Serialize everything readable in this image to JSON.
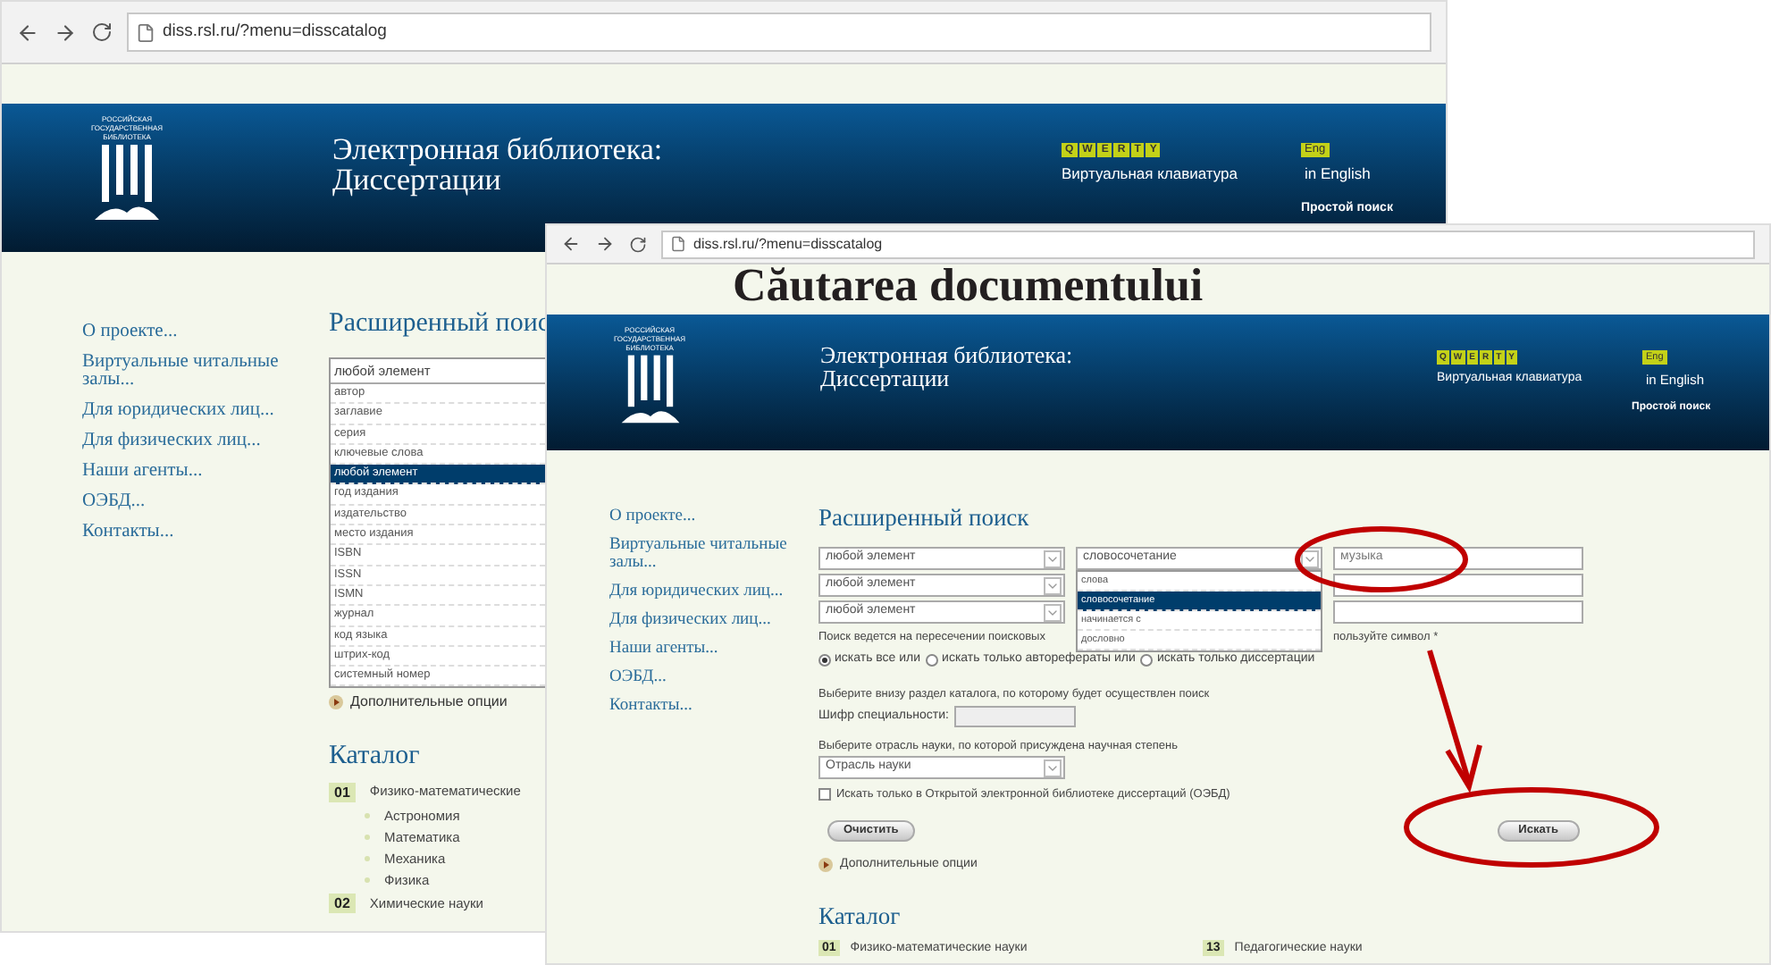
{
  "annotation_title": "Căutarea documentului",
  "back_window": {
    "kind": "back",
    "url": "diss.rsl.ru/?menu=disscatalog",
    "header": {
      "logo_lines": [
        "РОССИЙСКАЯ",
        "ГОСУДАРСТВЕННАЯ",
        "БИБЛИОТЕКА"
      ],
      "title_lines": [
        "Электронная библиотека:",
        "Диссертации"
      ],
      "keyboard_keys": [
        "Q",
        "W",
        "E",
        "R",
        "T",
        "Y"
      ],
      "keyboard_label": "Виртуальная клавиатура",
      "lang_badge": "Eng",
      "lang_link": "in English",
      "simple_search": "Простой поиск"
    },
    "nav": [
      "О проекте...",
      "Виртуальные читальные залы...",
      "Для юридических лиц...",
      "Для физических лиц...",
      "Наши агенты...",
      "ОЭБД...",
      "Контакты..."
    ],
    "search_title": "Расширенный поис",
    "field_listbox": {
      "value": "любой элемент",
      "options": [
        {
          "label": "автор",
          "selected": false
        },
        {
          "label": "заглавие",
          "selected": false
        },
        {
          "label": "серия",
          "selected": false
        },
        {
          "label": "ключевые слова",
          "selected": false
        },
        {
          "label": "любой элемент",
          "selected": true
        },
        {
          "label": "год издания",
          "selected": false
        },
        {
          "label": "издательство",
          "selected": false
        },
        {
          "label": "место издания",
          "selected": false
        },
        {
          "label": "ISBN",
          "selected": false
        },
        {
          "label": "ISSN",
          "selected": false
        },
        {
          "label": "ISMN",
          "selected": false
        },
        {
          "label": "журнал",
          "selected": false
        },
        {
          "label": "код языка",
          "selected": false
        },
        {
          "label": "штрих-код",
          "selected": false
        },
        {
          "label": "системный номер",
          "selected": false
        }
      ]
    },
    "more_options": "Дополнительные опции",
    "catalog": {
      "title": "Каталог",
      "sections": [
        {
          "code": "01",
          "name": "Физико-математические",
          "subsections": [
            "Астрономия",
            "Математика",
            "Механика",
            "Физика"
          ]
        },
        {
          "code": "02",
          "name": "Химические науки"
        }
      ]
    }
  },
  "front_window": {
    "kind": "front",
    "url": "diss.rsl.ru/?menu=disscatalog",
    "header": {
      "logo_lines": [
        "РОССИЙСКАЯ",
        "ГОСУДАРСТВЕННАЯ",
        "БИБЛИОТЕКА"
      ],
      "title_lines": [
        "Электронная библиотека:",
        "Диссертации"
      ],
      "keyboard_keys": [
        "Q",
        "W",
        "E",
        "R",
        "T",
        "Y"
      ],
      "keyboard_label": "Виртуальная клавиатура",
      "lang_badge": "Eng",
      "lang_link": "in English",
      "simple_search": "Простой поиск"
    },
    "nav": [
      "О проекте...",
      "Виртуальные читальные залы...",
      "Для юридических лиц...",
      "Для физических лиц...",
      "Наши агенты...",
      "ОЭБД...",
      "Контакты..."
    ],
    "search": {
      "title": "Расширенный поиск",
      "rows": [
        {
          "field": "любой элемент",
          "mode": "словосочетание",
          "query": "музыка"
        },
        {
          "field": "любой элемент"
        },
        {
          "field": "любой элемент"
        }
      ],
      "mode_options": [
        {
          "label": "слова",
          "selected": false
        },
        {
          "label": "словосочетание",
          "selected": true
        },
        {
          "label": "начинается с",
          "selected": false
        },
        {
          "label": "дословно",
          "selected": false
        }
      ],
      "hint_start": "Поиск ведется на пересечении поисковых",
      "hint_end": "пользуйте символ *",
      "scope_options": [
        {
          "label": "искать все или",
          "selected": true
        },
        {
          "label": "искать только авторефераты или",
          "selected": false
        },
        {
          "label": "искать только диссертации",
          "selected": false
        }
      ],
      "catalog_hint": "Выберите внизу раздел каталога, по которому будет осуществлен поиск",
      "code_label": "Шифр специальности:",
      "branch_hint": "Выберите отрасль науки, по которой присуждена научная степень",
      "branch_select": "Отрасль науки",
      "oebd_checkbox": {
        "label": "Искать только в Открытой электронной библиотеке диссертаций (ОЭБД)",
        "checked": false
      },
      "clear_button": "Очистить",
      "search_button": "Искать",
      "more_options": "Дополнительные опции"
    },
    "catalog": {
      "title": "Каталог",
      "sections": [
        {
          "code": "01",
          "name": "Физико-математические науки"
        },
        {
          "code": "13",
          "name": "Педагогические науки"
        }
      ]
    }
  }
}
